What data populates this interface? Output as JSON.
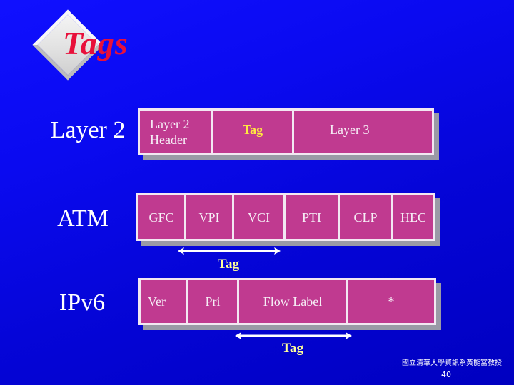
{
  "slide": {
    "title": "Tags",
    "logo_icon": "beveled-diamond-icon",
    "colors": {
      "background": "#0a0af0",
      "box_fill": "#c03a90",
      "box_border": "#f2e8f2",
      "box_shadow": "#9a9aa6",
      "title": "#e8103a",
      "tag_text": "#ffe840",
      "tag_label": "#ffff99"
    }
  },
  "rows": [
    {
      "label": "Layer 2",
      "fields": [
        {
          "text_lines": [
            "Layer 2",
            "Header"
          ],
          "highlight": false
        },
        {
          "text": "Tag",
          "highlight": true
        },
        {
          "text": "Layer 3",
          "highlight": false
        }
      ]
    },
    {
      "label": "ATM",
      "fields": [
        {
          "text": "GFC"
        },
        {
          "text": "VPI"
        },
        {
          "text": "VCI"
        },
        {
          "text": "PTI"
        },
        {
          "text": "CLP"
        },
        {
          "text": "HEC"
        }
      ],
      "tag_span": {
        "from_field": "VPI",
        "to_field": "VCI",
        "label": "Tag"
      }
    },
    {
      "label": "IPv6",
      "fields": [
        {
          "text": "Ver"
        },
        {
          "text": "Pri"
        },
        {
          "text": "Flow Label"
        },
        {
          "text": "*"
        }
      ],
      "tag_span": {
        "from_field": "Flow Label",
        "to_field": "Flow Label",
        "label": "Tag"
      }
    }
  ],
  "footer": {
    "author": "國立清華大學資訊系黃能富教授",
    "page_number": "40"
  }
}
